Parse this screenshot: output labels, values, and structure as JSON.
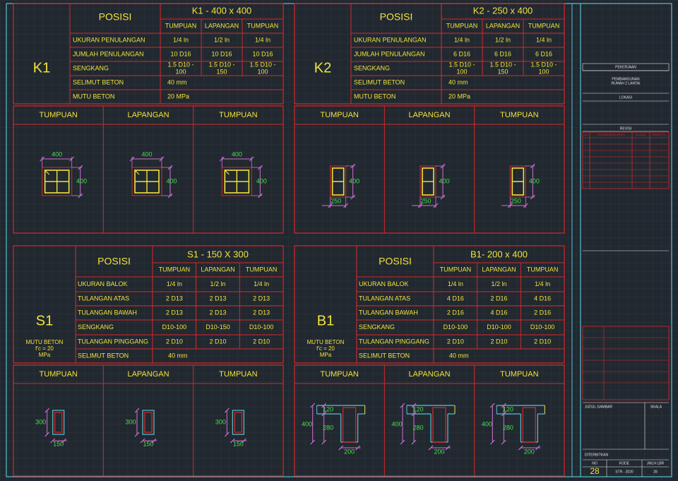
{
  "colors": {
    "background": "#212830",
    "grid": "#2d3540",
    "frame": "#59c3d3",
    "table_line": "#d92727",
    "text_yellow": "#f2e33a",
    "dim_purple": "#d36fd4",
    "dim_green": "#48e04a",
    "beam_cyan": "#59c3d3",
    "white_text": "#e6e6e6"
  },
  "k1": {
    "mark": "K1",
    "posisi": "POSISI",
    "title": "K1 - 400 x 400",
    "cols": [
      "TUMPUAN",
      "LAPANGAN",
      "TUMPUAN"
    ],
    "rows": [
      {
        "label": "UKURAN PENULANGAN",
        "values": [
          "1/4 ln",
          "1/2 ln",
          "1/4 ln"
        ]
      },
      {
        "label": "JUMLAH PENULANGAN",
        "values": [
          "10 D16",
          "10 D16",
          "10 D16"
        ]
      },
      {
        "label": "SENGKANG",
        "values": [
          "1.5 D10 - 100",
          "1.5 D10 - 150",
          "1.5 D10 - 100"
        ]
      },
      {
        "label": "SELIMUT BETON",
        "value": "40 mm"
      },
      {
        "label": "MUTU BETON",
        "value": "20 MPa"
      }
    ],
    "sections": [
      "TUMPUAN",
      "LAPANGAN",
      "TUMPUAN"
    ],
    "dim_w": "400",
    "dim_h": "400"
  },
  "k2": {
    "mark": "K2",
    "posisi": "POSISI",
    "title": "K2 - 250 x 400",
    "cols": [
      "TUMPUAN",
      "LAPANGAN",
      "TUMPUAN"
    ],
    "rows": [
      {
        "label": "UKURAN PENULANGAN",
        "values": [
          "1/4 ln",
          "1/2 ln",
          "1/4 ln"
        ]
      },
      {
        "label": "JUMLAH PENULANGAN",
        "values": [
          "6 D16",
          "6 D16",
          "6 D16"
        ]
      },
      {
        "label": "SENGKANG",
        "values": [
          "1.5 D10 - 100",
          "1.5 D10 - 150",
          "1.5 D10 - 100"
        ]
      },
      {
        "label": "SELIMUT BETON",
        "value": "40 mm"
      },
      {
        "label": "MUTU BETON",
        "value": "20 MPa"
      }
    ],
    "sections": [
      "TUMPUAN",
      "LAPANGAN",
      "TUMPUAN"
    ],
    "dim_w": "250",
    "dim_h": "400"
  },
  "s1": {
    "mark": "S1",
    "note1": "MUTU BETON",
    "note2": "f'c = 20",
    "note3": "MPa",
    "posisi": "POSISI",
    "title": "S1 - 150 X 300",
    "cols": [
      "TUMPUAN",
      "LAPANGAN",
      "TUMPUAN"
    ],
    "rows": [
      {
        "label": "UKURAN BALOK",
        "values": [
          "1/4 ln",
          "1/2 ln",
          "1/4 ln"
        ]
      },
      {
        "label": "TULANGAN ATAS",
        "values": [
          "2 D13",
          "2 D13",
          "2 D13"
        ]
      },
      {
        "label": "TULANGAN BAWAH",
        "values": [
          "2 D13",
          "2 D13",
          "2 D13"
        ]
      },
      {
        "label": "SENGKANG",
        "values": [
          "D10-100",
          "D10-150",
          "D10-100"
        ]
      },
      {
        "label": "TULANGAN PINGGANG",
        "values": [
          "2 D10",
          "2 D10",
          "2 D10"
        ]
      },
      {
        "label": "SELIMUT BETON",
        "value": "40 mm"
      }
    ],
    "sections": [
      "TUMPUAN",
      "LAPANGAN",
      "TUMPUAN"
    ],
    "dim_w": "150",
    "dim_h": "300"
  },
  "b1": {
    "mark": "B1",
    "note1": "MUTU BETON",
    "note2": "f'c = 20",
    "note3": "MPa",
    "posisi": "POSISI",
    "title": "B1- 200 x 400",
    "cols": [
      "TUMPUAN",
      "LAPANGAN",
      "TUMPUAN"
    ],
    "rows": [
      {
        "label": "UKURAN BALOK",
        "values": [
          "1/4 ln",
          "1/2 ln",
          "1/4 ln"
        ]
      },
      {
        "label": "TULANGAN ATAS",
        "values": [
          "4 D16",
          "2 D16",
          "4 D16"
        ]
      },
      {
        "label": "TULANGAN BAWAH",
        "values": [
          "2 D16",
          "4 D16",
          "2 D16"
        ]
      },
      {
        "label": "SENGKANG",
        "values": [
          "D10-100",
          "D10-100",
          "D10-100"
        ]
      },
      {
        "label": "TULANGAN PINGGANG",
        "values": [
          "2 D10",
          "2 D10",
          "2 D10"
        ]
      },
      {
        "label": "SELIMUT BETON",
        "value": "40 mm"
      }
    ],
    "sections": [
      "TUMPUAN",
      "LAPANGAN",
      "TUMPUAN"
    ],
    "dim_w": "200",
    "dim_h": "400",
    "dim_slab": "120",
    "dim_web": "280"
  },
  "title_block": {
    "pekerjaan": "PEKERJAAN",
    "project1": "PEMBANGUNAN",
    "project2": "RUMAH 2 LANTAI",
    "lokasi": "LOKASI",
    "revisi": "REVISI",
    "rev_cols": [
      "NO",
      "PERUBAHAN/KOREKSI",
      "TGL/BLN",
      "PARAF/TTD"
    ],
    "judul": "JUDUL GAMBAR",
    "skala": "SKALA",
    "diterbitkan": "DITERBITKAN",
    "no_label": "NO",
    "kode_label": "KODE",
    "jml_label": "JMLH LBR",
    "no_value": "28",
    "kode_value": "STR - 2020",
    "jml_value": "28"
  }
}
